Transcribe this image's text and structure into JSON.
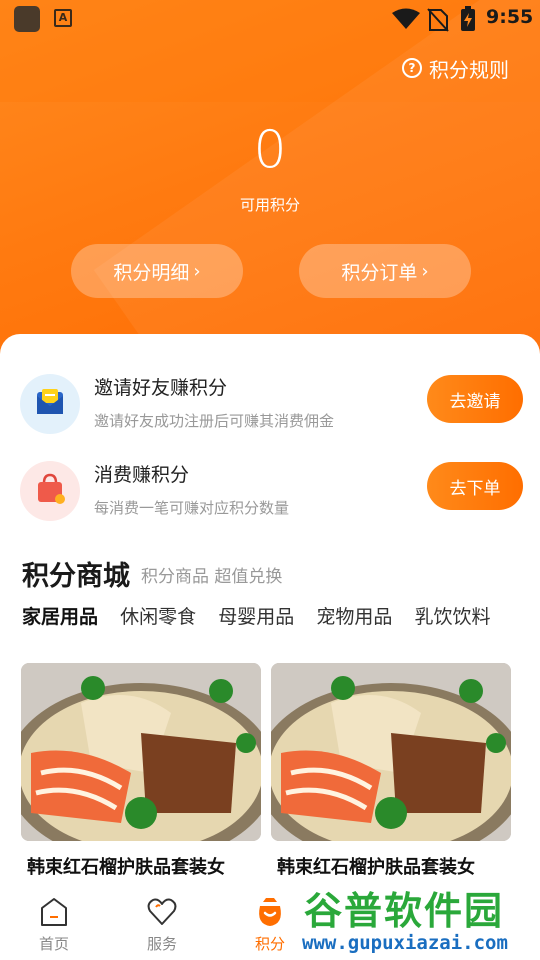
{
  "status_bar": {
    "time": "9:55",
    "a_icon_letter": "A"
  },
  "header": {
    "rules_label": "积分规则",
    "points_value": "0",
    "points_label": "可用积分",
    "detail_button": "积分明细",
    "orders_button": "积分订单",
    "chevron": "›"
  },
  "tasks": [
    {
      "title": "邀请好友赚积分",
      "desc": "邀请好友成功注册后可赚其消费佣金",
      "button": "去邀请",
      "icon": "invite-envelope-icon"
    },
    {
      "title": "消费赚积分",
      "desc": "每消费一笔可赚对应积分数量",
      "button": "去下单",
      "icon": "shopping-bag-icon"
    }
  ],
  "mall": {
    "title": "积分商城",
    "subtitle": "积分商品 超值兑换",
    "categories": [
      "家居用品",
      "休闲零食",
      "母婴用品",
      "宠物用品",
      "乳饮饮料"
    ],
    "active_category": 0,
    "products": [
      {
        "name": "韩束红石榴护肤品套装女"
      },
      {
        "name": "韩束红石榴护肤品套装女"
      }
    ]
  },
  "tabbar": {
    "items": [
      {
        "label": "首页",
        "icon": "home-icon"
      },
      {
        "label": "服务",
        "icon": "heart-icon"
      },
      {
        "label": "积分",
        "icon": "points-bag-icon",
        "active": true
      }
    ]
  },
  "watermark": {
    "text": "谷普软件园",
    "url": "www.gupuxiazai.com"
  },
  "colors": {
    "accent": "#ff6e00",
    "header": "#ff7a10",
    "muted": "#999999"
  }
}
